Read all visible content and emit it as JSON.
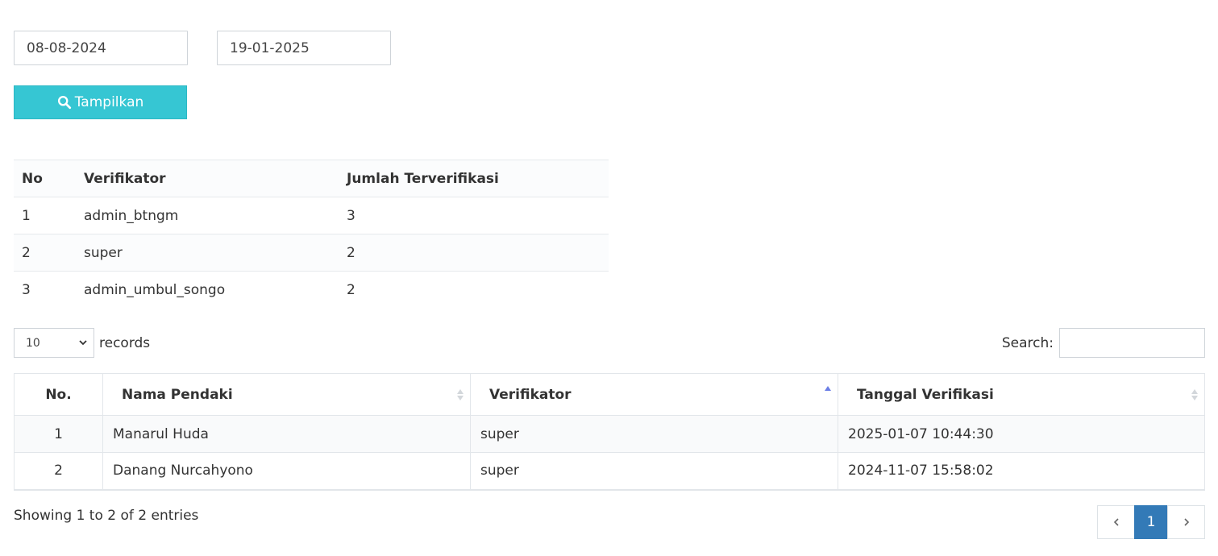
{
  "filter": {
    "date_from": "08-08-2024",
    "date_to": "19-01-2025",
    "show_button": "Tampilkan"
  },
  "summary": {
    "headers": [
      "No",
      "Verifikator",
      "Jumlah Terverifikasi"
    ],
    "rows": [
      {
        "no": "1",
        "verifikator": "admin_btngm",
        "jumlah": "3"
      },
      {
        "no": "2",
        "verifikator": "super",
        "jumlah": "2"
      },
      {
        "no": "3",
        "verifikator": "admin_umbul_songo",
        "jumlah": "2"
      }
    ]
  },
  "length_menu": {
    "selected": "10",
    "suffix": "records"
  },
  "search": {
    "label": "Search:",
    "value": ""
  },
  "table": {
    "headers": [
      "No.",
      "Nama Pendaki",
      "Verifikator",
      "Tanggal Verifikasi"
    ],
    "rows": [
      {
        "no": "1",
        "nama": "Manarul Huda",
        "verifikator": "super",
        "tanggal": "2025-01-07 10:44:30"
      },
      {
        "no": "2",
        "nama": "Danang Nurcahyono",
        "verifikator": "super",
        "tanggal": "2024-11-07 15:58:02"
      }
    ]
  },
  "info": "Showing 1 to 2 of 2 entries",
  "pagination": {
    "current": "1"
  },
  "colors": {
    "button": "#36c6d3",
    "active_page": "#337ab7",
    "sort_active": "#6b7ee6"
  }
}
